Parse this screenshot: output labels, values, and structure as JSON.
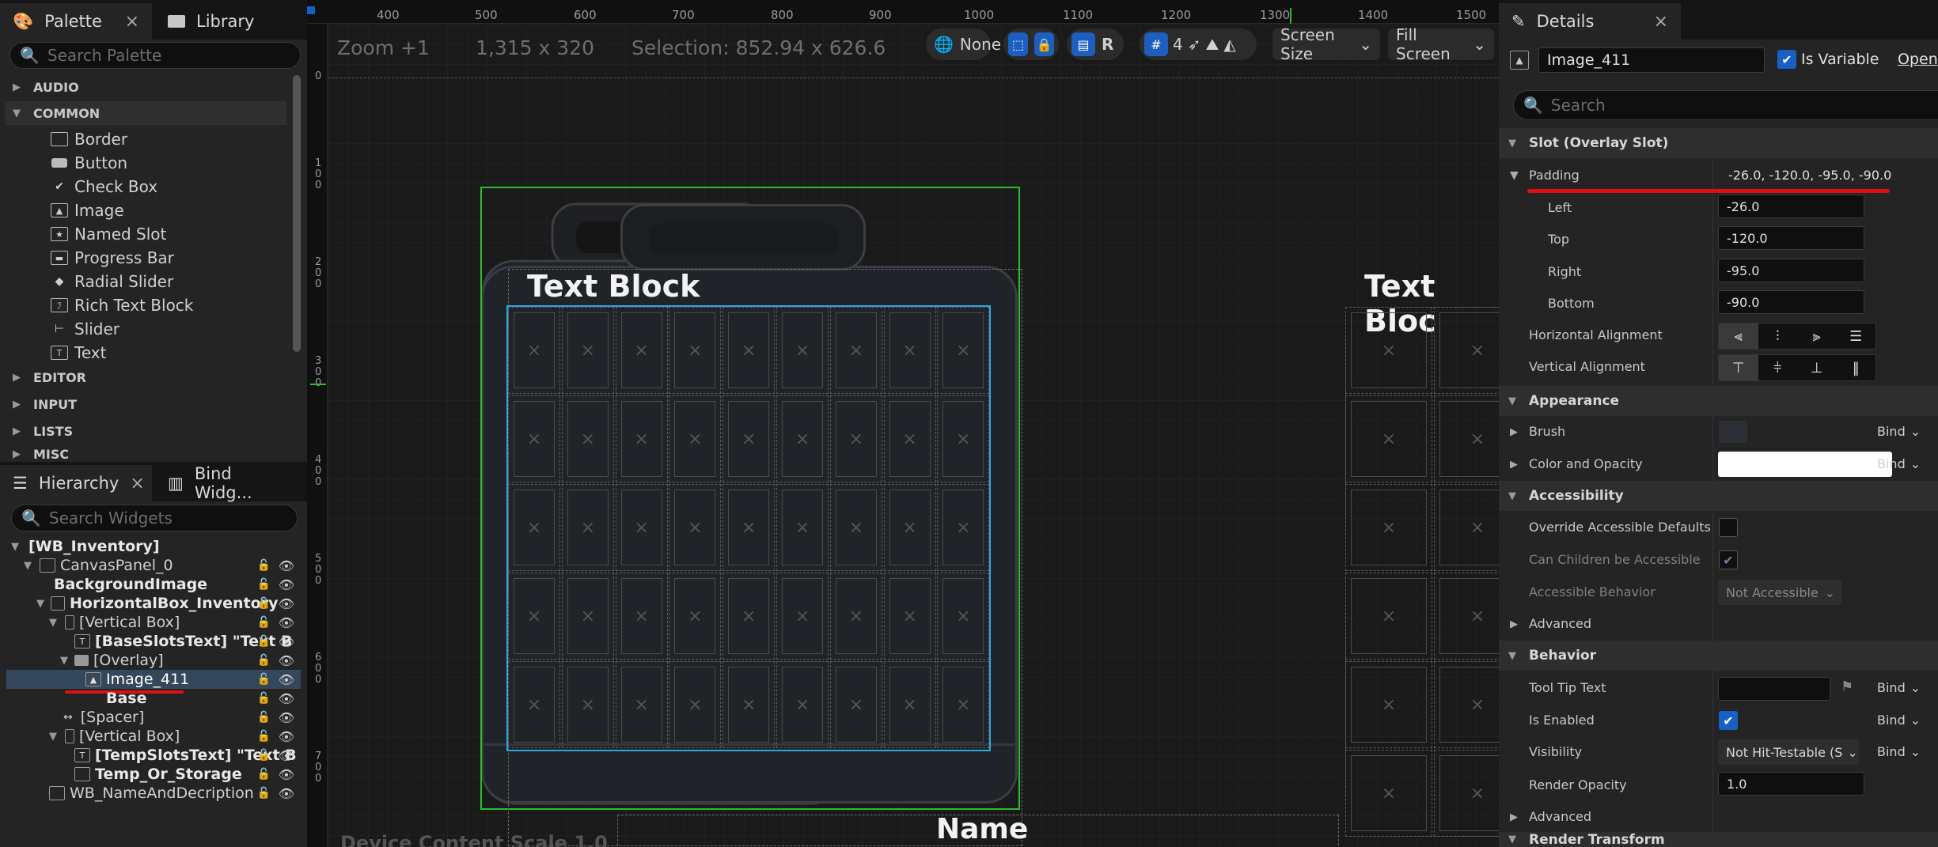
{
  "palette": {
    "tab_palette": "Palette",
    "tab_library": "Library",
    "search_placeholder": "Search Palette",
    "categories": {
      "audio": "AUDIO",
      "common": "COMMON",
      "editor": "EDITOR",
      "input": "INPUT",
      "lists": "LISTS",
      "misc": "MISC"
    },
    "common_items": [
      "Border",
      "Button",
      "Check Box",
      "Image",
      "Named Slot",
      "Progress Bar",
      "Radial Slider",
      "Rich Text Block",
      "Slider",
      "Text"
    ]
  },
  "hierarchy": {
    "tab_hierarchy": "Hierarchy",
    "tab_bind": "Bind Widg...",
    "search_placeholder": "Search Widgets",
    "rows": [
      "[WB_Inventory]",
      "CanvasPanel_0",
      "BackgroundImage",
      "HorizontalBox_Inventory",
      "[Vertical Box]",
      "[BaseSlotsText] \"Text B",
      "[Overlay]",
      "Image_411",
      "Base",
      "[Spacer]",
      "[Vertical Box]",
      "[TempSlotsText] \"Text B",
      "Temp_Or_Storage",
      "WB_NameAndDecription"
    ]
  },
  "viewport": {
    "zoom": "Zoom +1",
    "resolution": "1,315 x 320",
    "selection": "Selection: 852.94 x 626.6",
    "none_label": "None",
    "r_label": "R",
    "grid_count": "4",
    "screen_size": "Screen Size",
    "fill_screen": "Fill Screen",
    "ruler_top": [
      "400",
      "500",
      "600",
      "700",
      "800",
      "900",
      "1000",
      "1100",
      "1200",
      "1300",
      "1400",
      "1500"
    ],
    "ruler_left": [
      "0",
      "100",
      "200",
      "300",
      "400",
      "500",
      "600",
      "700"
    ],
    "text_block_1": "Text Block",
    "text_block_2": "Text Bloc",
    "name_label": "Name",
    "device_scale": "Device Content Scale 1.0"
  },
  "details": {
    "tab": "Details",
    "widget_name": "Image_411",
    "is_variable": "Is Variable",
    "open": "Open",
    "search_placeholder": "Search",
    "sections": {
      "slot": "Slot (Overlay Slot)",
      "appearance": "Appearance",
      "accessibility": "Accessibility",
      "behavior": "Behavior"
    },
    "padding_label": "Padding",
    "padding_value": "-26.0, -120.0, -95.0, -90.0",
    "left_label": "Left",
    "left_value": "-26.0",
    "top_label": "Top",
    "top_value": "-120.0",
    "right_label": "Right",
    "right_value": "-95.0",
    "bottom_label": "Bottom",
    "bottom_value": "-90.0",
    "halign_label": "Horizontal Alignment",
    "valign_label": "Vertical Alignment",
    "brush_label": "Brush",
    "color_label": "Color and Opacity",
    "bind": "Bind",
    "override_label": "Override Accessible Defaults",
    "can_children_label": "Can Children be Accessible",
    "behavior_label": "Accessible Behavior",
    "behavior_value": "Not Accessible",
    "advanced": "Advanced",
    "tooltip_label": "Tool Tip Text",
    "enabled_label": "Is Enabled",
    "visibility_label": "Visibility",
    "visibility_value": "Not Hit-Testable (S",
    "opacity_label": "Render Opacity",
    "opacity_value": "1.0",
    "render_transform": "Render Transform"
  },
  "colors": {
    "accent_blue": "#1760c4",
    "selection_green": "#2dbe2d",
    "underline_red": "#e01010"
  }
}
